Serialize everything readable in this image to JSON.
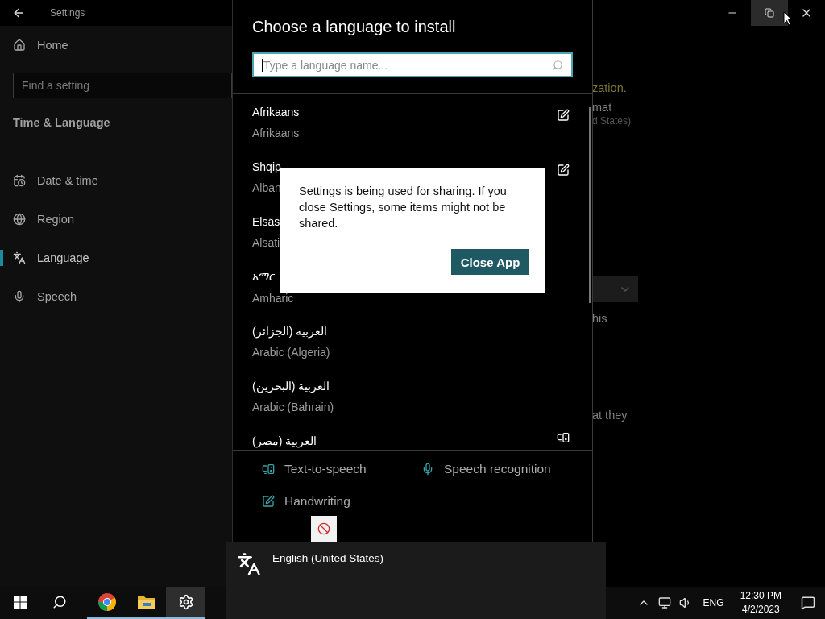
{
  "settings_window": {
    "title": "Settings",
    "home": "Home",
    "search_placeholder": "Find a setting",
    "section": "Time & Language",
    "nav": [
      {
        "label": "Date & time",
        "kind": "date",
        "selected": false
      },
      {
        "label": "Region",
        "kind": "region",
        "selected": false
      },
      {
        "label": "Language",
        "kind": "language",
        "selected": true
      },
      {
        "label": "Speech",
        "kind": "speech",
        "selected": false
      }
    ],
    "content_fragments": [
      {
        "kind": "link",
        "text": "zation."
      },
      {
        "kind": "label",
        "text": "mat"
      },
      {
        "kind": "caption",
        "text": "d States)"
      },
      {
        "kind": "dropdown"
      },
      {
        "kind": "text",
        "text": "his"
      },
      {
        "kind": "text",
        "text": "at they"
      }
    ]
  },
  "language_panel": {
    "title": "Choose a language to install",
    "search_placeholder": "Type a language name...",
    "languages": [
      {
        "native": "Afrikaans",
        "english": "Afrikaans",
        "handwriting": true,
        "tts": false
      },
      {
        "native": "Shqip",
        "english": "Alban",
        "handwriting": true,
        "tts": false
      },
      {
        "native": "Elsäs",
        "english": "Alsati"
      },
      {
        "native": "አማር",
        "english": "Amharic"
      },
      {
        "native": "العربية (الجزائر)",
        "english": "Arabic (Algeria)"
      },
      {
        "native": "العربية (البحرين)",
        "english": "Arabic (Bahrain)"
      },
      {
        "native": "العربية (مصر)",
        "handwriting": false,
        "tts": true
      }
    ],
    "legend": [
      {
        "kind": "tts",
        "label": "Text-to-speech"
      },
      {
        "kind": "speech",
        "label": "Speech recognition"
      },
      {
        "kind": "handwriting",
        "label": "Handwriting"
      }
    ]
  },
  "dialog": {
    "message": "Settings is being used for sharing. If you close Settings, some items might not be shared.",
    "button": "Close App"
  },
  "language_flyout": {
    "language": "English (United States)"
  },
  "taskbar": {
    "apps": [
      {
        "kind": "start",
        "running": false,
        "selected": false
      },
      {
        "kind": "search",
        "running": false,
        "selected": false
      },
      {
        "kind": "chrome",
        "running": true,
        "selected": false
      },
      {
        "kind": "explorer",
        "running": true,
        "selected": false
      },
      {
        "kind": "settings",
        "running": true,
        "selected": true
      }
    ],
    "input_language": "ENG",
    "time": "12:30 PM",
    "date": "4/2/2023"
  }
}
